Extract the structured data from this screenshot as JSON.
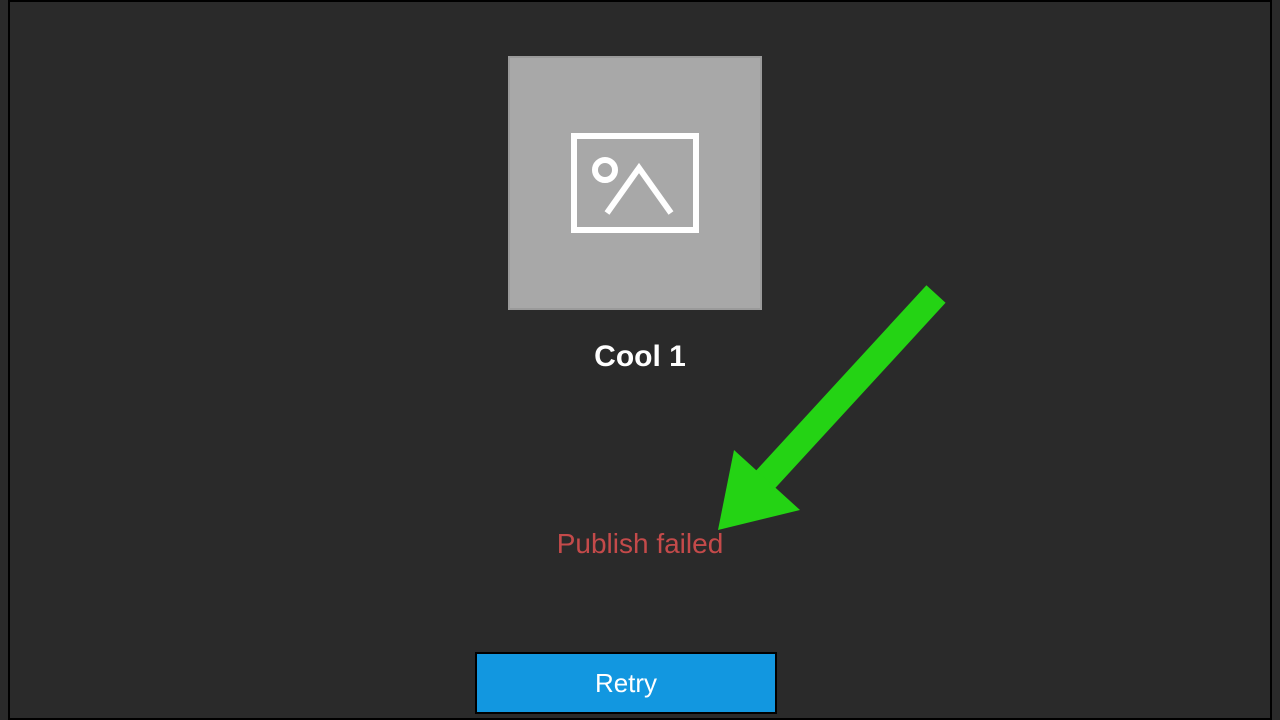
{
  "item": {
    "title": "Cool 1"
  },
  "status": {
    "message": "Publish failed"
  },
  "actions": {
    "retry_label": "Retry"
  },
  "colors": {
    "background": "#2a2a2a",
    "thumbnail_bg": "#a8a8a8",
    "error_text": "#c44a4a",
    "button_bg": "#1297e0",
    "annotation_arrow": "#24d314"
  }
}
